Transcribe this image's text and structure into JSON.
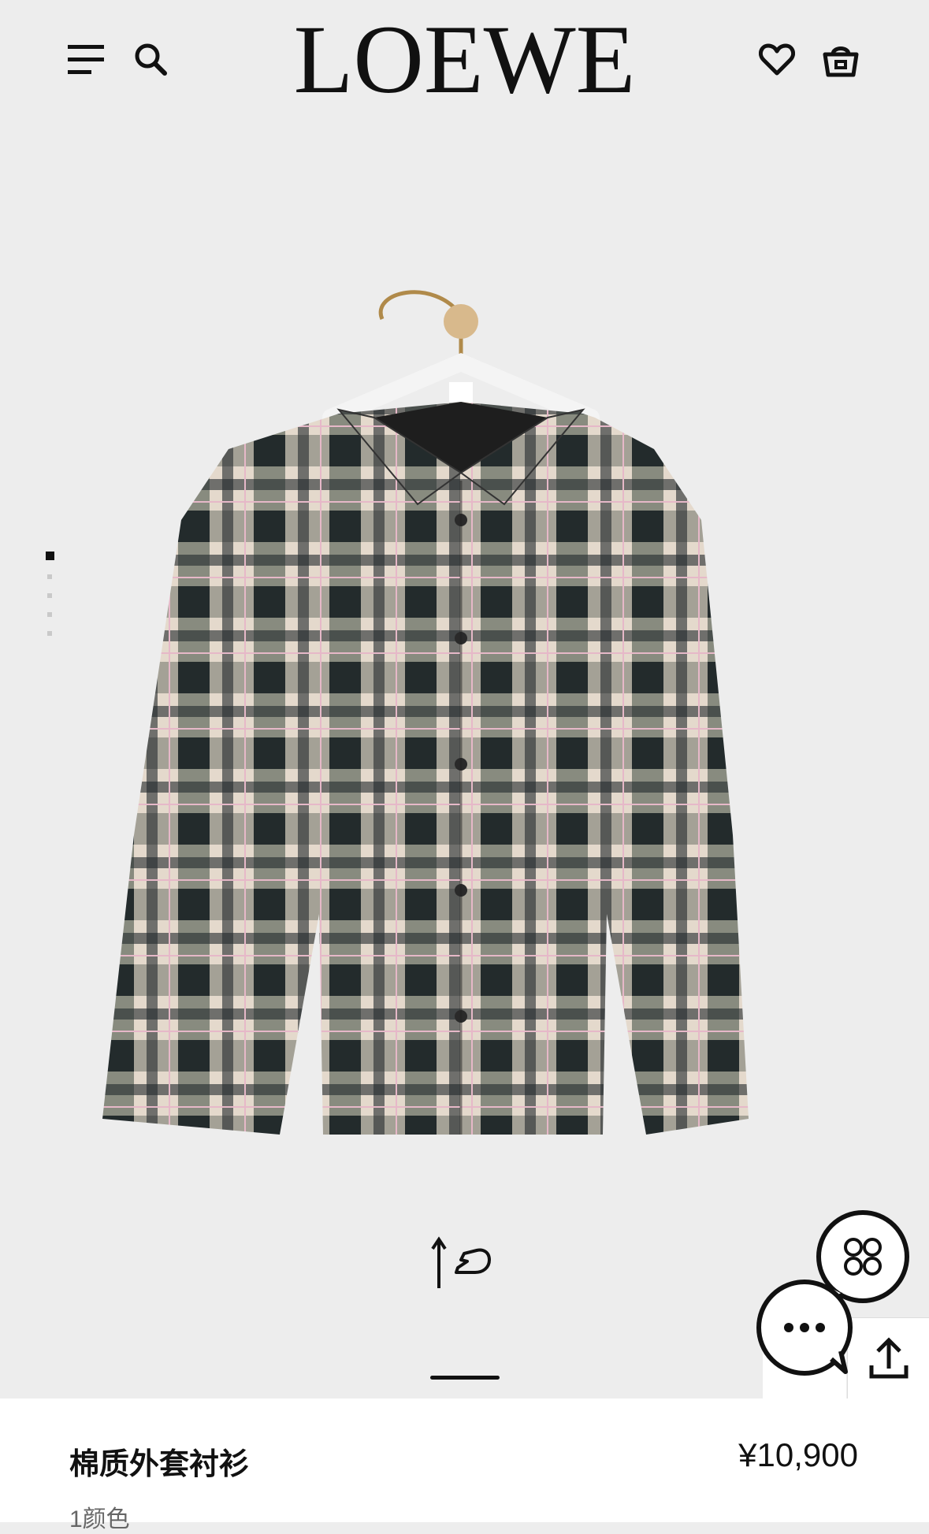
{
  "header": {
    "brand": "LOEWE",
    "icons": {
      "menu": "menu-icon",
      "search": "search-icon",
      "wishlist": "heart-icon",
      "bag": "basket-icon"
    }
  },
  "gallery": {
    "image_count": 6,
    "active_index": 1,
    "hanger_logo": "LOEWE anagram",
    "swipe_hint_icon": "swipe-up-hand-icon"
  },
  "floating": {
    "chat_icon": "chat-bubble-icon",
    "brand_bubble_icon": "loewe-anagram-icon",
    "share_icon": "share-icon"
  },
  "product": {
    "title": "棉质外套衬衫",
    "price": "¥10,900",
    "colors": "1颜色"
  },
  "colors": {
    "background": "#ededed",
    "text": "#111111",
    "muted": "#666666"
  }
}
